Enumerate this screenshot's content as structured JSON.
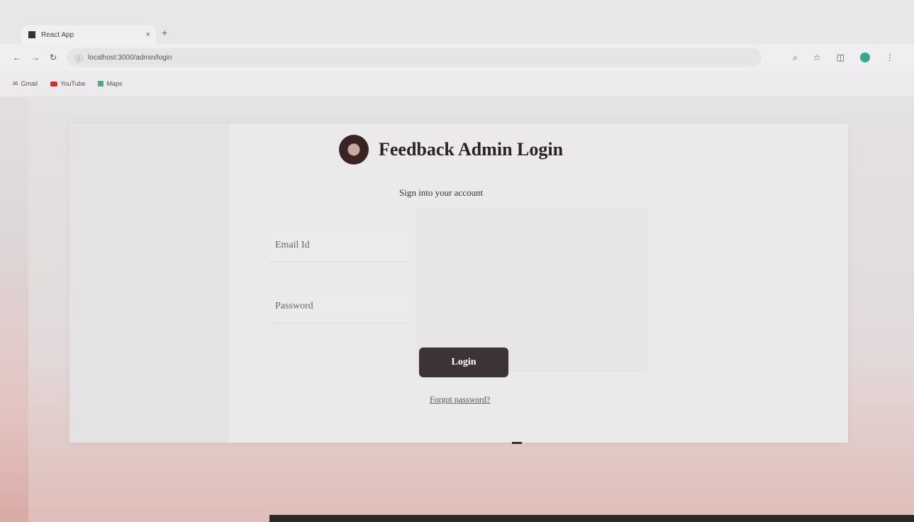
{
  "browser": {
    "tab_title": "React App",
    "tab_close": "×",
    "new_tab": "+",
    "url": "localhost:3000/admin/login",
    "bookmarks": [
      {
        "label": "Gmail"
      },
      {
        "label": "YouTube"
      },
      {
        "label": "Maps"
      }
    ]
  },
  "page": {
    "title": "Feedback Admin Login",
    "subtitle": "Sign into your account",
    "email_placeholder": "Email Id",
    "password_placeholder": "Password",
    "login_label": "Login",
    "forgot_label": "Forgot password?"
  },
  "colors": {
    "button": "#3b3336",
    "accent_profile": "#3aa58f"
  }
}
